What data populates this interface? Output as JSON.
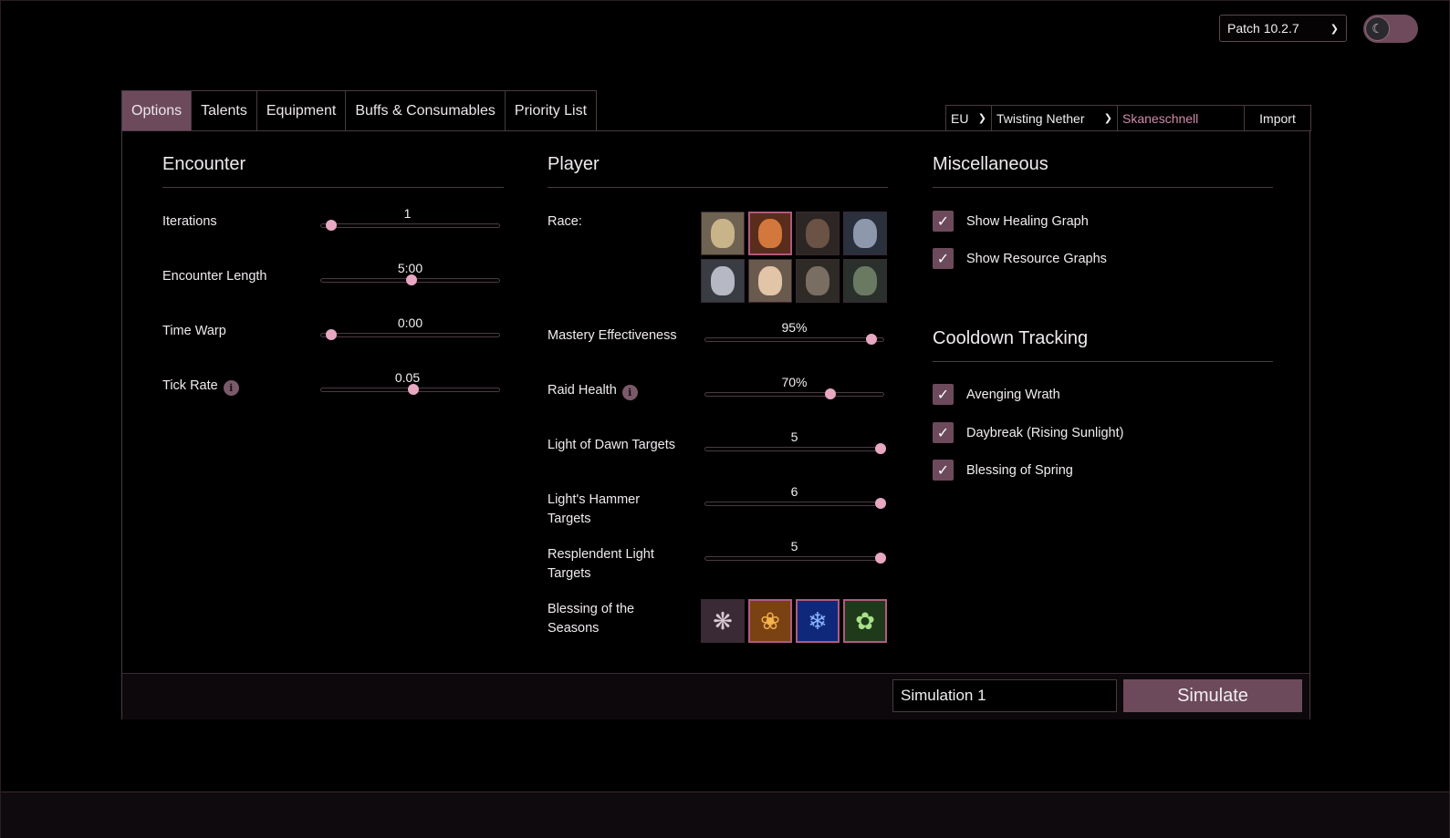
{
  "header": {
    "patch_label": "Patch 10.2.7",
    "theme_toggle_icon": "moon-icon"
  },
  "tabs": [
    {
      "label": "Options",
      "active": true
    },
    {
      "label": "Talents",
      "active": false
    },
    {
      "label": "Equipment",
      "active": false
    },
    {
      "label": "Buffs & Consumables",
      "active": false
    },
    {
      "label": "Priority List",
      "active": false
    }
  ],
  "import": {
    "region": "EU",
    "realm": "Twisting Nether",
    "character": "Skaneschnell",
    "button_label": "Import"
  },
  "encounter": {
    "title": "Encounter",
    "iterations_label": "Iterations",
    "iterations_value": "1",
    "iterations_fraction": 0.06,
    "length_label": "Encounter Length",
    "length_value": "5:00",
    "length_fraction": 0.51,
    "timewarp_label": "Time Warp",
    "timewarp_value": "0:00",
    "timewarp_fraction": 0.06,
    "tickrate_label": "Tick Rate",
    "tickrate_value": "0.05",
    "tickrate_fraction": 0.52
  },
  "player": {
    "title": "Player",
    "race_label": "Race:",
    "selected_race_index": 1,
    "mastery_label": "Mastery Effectiveness",
    "mastery_value": "95%",
    "mastery_fraction": 0.93,
    "raid_health_label": "Raid Health",
    "raid_health_value": "70%",
    "raid_health_fraction": 0.7,
    "lod_label": "Light of Dawn Targets",
    "lod_value": "5",
    "lod_fraction": 0.98,
    "lh_label": "Light's Hammer Targets",
    "lh_value": "6",
    "lh_fraction": 0.98,
    "rl_label": "Resplendent Light Targets",
    "rl_value": "5",
    "rl_fraction": 0.98,
    "seasons_label": "Blessing of the Seasons",
    "selected_season_indices": [
      1,
      2,
      3
    ]
  },
  "misc": {
    "title": "Miscellaneous",
    "show_healing_graph": "Show Healing Graph",
    "show_resource_graphs": "Show Resource Graphs"
  },
  "cooldowns": {
    "title": "Cooldown Tracking",
    "avenging_wrath": "Avenging Wrath",
    "daybreak": "Daybreak (Rising Sunlight)",
    "blessing_of_spring": "Blessing of Spring"
  },
  "footer": {
    "sim_name": "Simulation 1",
    "simulate_label": "Simulate"
  },
  "colors": {
    "accent": "#6c4a5c",
    "thumb": "#e8a8c2",
    "character_name": "#d08aa8"
  }
}
